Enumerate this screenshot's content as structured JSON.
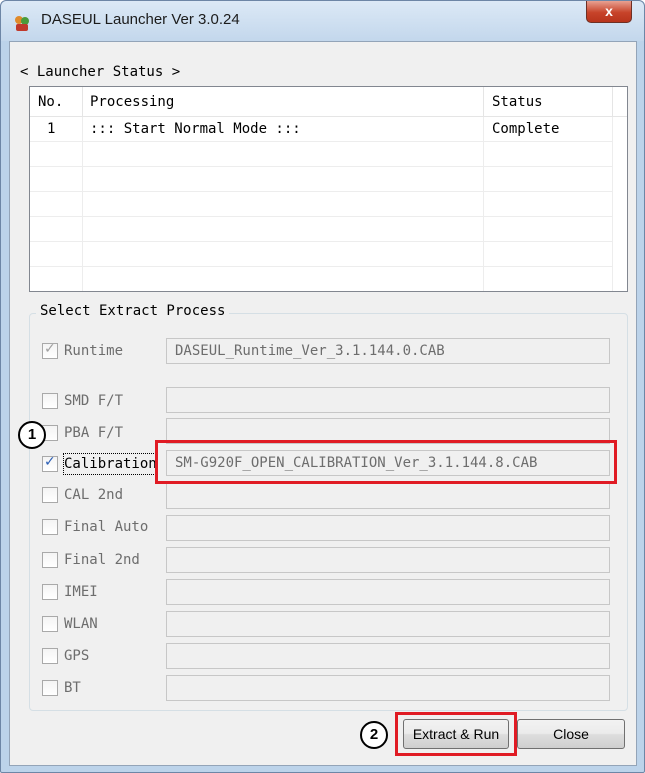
{
  "window": {
    "title": "DASEUL Launcher Ver 3.0.24",
    "close_label": "x"
  },
  "launcher_status": {
    "label": "< Launcher Status >",
    "columns": [
      "No.",
      "Processing",
      "Status"
    ],
    "rows": [
      {
        "no": "1",
        "processing": "::: Start Normal Mode :::",
        "status": "Complete"
      }
    ]
  },
  "extract": {
    "title": "Select Extract Process",
    "items": [
      {
        "label": "Runtime",
        "checked": true,
        "enabled": false,
        "value": "DASEUL_Runtime_Ver_3.1.144.0.CAB"
      },
      {
        "label": "SMD F/T",
        "checked": false,
        "enabled": true,
        "value": ""
      },
      {
        "label": "PBA F/T",
        "checked": false,
        "enabled": true,
        "value": ""
      },
      {
        "label": "Calibration",
        "checked": true,
        "enabled": true,
        "value": "SM-G920F_OPEN_CALIBRATION_Ver_3.1.144.8.CAB"
      },
      {
        "label": "CAL 2nd",
        "checked": false,
        "enabled": true,
        "value": ""
      },
      {
        "label": "Final Auto",
        "checked": false,
        "enabled": true,
        "value": ""
      },
      {
        "label": "Final 2nd",
        "checked": false,
        "enabled": true,
        "value": ""
      },
      {
        "label": "IMEI",
        "checked": false,
        "enabled": true,
        "value": ""
      },
      {
        "label": "WLAN",
        "checked": false,
        "enabled": true,
        "value": ""
      },
      {
        "label": "GPS",
        "checked": false,
        "enabled": true,
        "value": ""
      },
      {
        "label": "BT",
        "checked": false,
        "enabled": true,
        "value": ""
      }
    ]
  },
  "buttons": {
    "extract_run": "Extract & Run",
    "close": "Close"
  },
  "annotations": {
    "step1": "1",
    "step2": "2",
    "highlight_color": "#e01b24"
  }
}
